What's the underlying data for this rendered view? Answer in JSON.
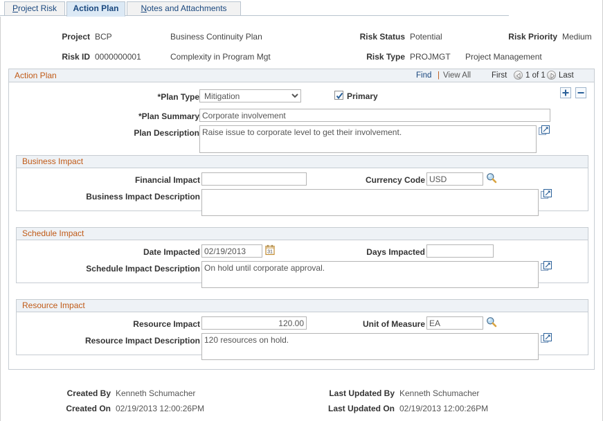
{
  "tabs": [
    {
      "label": "Project Risk",
      "accesskey": "P",
      "active": false
    },
    {
      "label": "Action Plan",
      "accesskey": "A",
      "active": true
    },
    {
      "label": "Notes and Attachments",
      "accesskey": "N",
      "active": true
    }
  ],
  "header": {
    "project_label": "Project",
    "project_value": "BCP",
    "project_desc": "Business Continuity Plan",
    "risk_id_label": "Risk ID",
    "risk_id_value": "0000000001",
    "risk_desc": "Complexity in Program Mgt",
    "risk_status_label": "Risk Status",
    "risk_status_value": "Potential",
    "risk_priority_label": "Risk Priority",
    "risk_priority_value": "Medium",
    "risk_type_label": "Risk Type",
    "risk_type_value": "PROJMGT",
    "risk_type_desc": "Project Management"
  },
  "action_plan": {
    "title": "Action Plan",
    "find_label": "Find",
    "separator": "|",
    "view_all_label": "View All",
    "first_label": "First",
    "counter": "1 of 1",
    "last_label": "Last",
    "add_row_label": "+",
    "delete_row_label": "-",
    "plan_type_label": "*Plan Type",
    "plan_type_value": "Mitigation",
    "plan_type_options": [
      "Mitigation"
    ],
    "primary_label": "Primary",
    "primary_checked": true,
    "plan_summary_label": "*Plan Summary",
    "plan_summary_value": "Corporate involvement",
    "plan_description_label": "Plan Description",
    "plan_description_value": "Raise issue to corporate level to get their involvement."
  },
  "business_impact": {
    "title": "Business Impact",
    "financial_impact_label": "Financial Impact",
    "financial_impact_value": "",
    "currency_code_label": "Currency Code",
    "currency_code_value": "USD",
    "description_label": "Business Impact Description",
    "description_value": ""
  },
  "schedule_impact": {
    "title": "Schedule Impact",
    "date_impacted_label": "Date Impacted",
    "date_impacted_value": "02/19/2013",
    "days_impacted_label": "Days Impacted",
    "days_impacted_value": "",
    "description_label": "Schedule Impact Description",
    "description_value": "On hold until corporate approval."
  },
  "resource_impact": {
    "title": "Resource Impact",
    "resource_impact_label": "Resource Impact",
    "resource_impact_value": "120.00",
    "unit_of_measure_label": "Unit of Measure",
    "unit_of_measure_value": "EA",
    "description_label": "Resource Impact Description",
    "description_value": "120 resources on hold."
  },
  "audit": {
    "created_by_label": "Created By",
    "created_by_value": "Kenneth Schumacher",
    "created_on_label": "Created On",
    "created_on_value": "02/19/2013 12:00:26PM",
    "last_updated_by_label": "Last Updated By",
    "last_updated_by_value": "Kenneth Schumacher",
    "last_updated_on_label": "Last Updated On",
    "last_updated_on_value": "02/19/2013 12:00:26PM"
  },
  "icons": {
    "expand_icon": "expand-textarea-icon",
    "lookup_icon": "magnifying-glass-lookup-icon",
    "calendar_icon": "calendar-picker-icon",
    "prev_icon": "previous-arrow-icon",
    "next_icon": "next-arrow-icon"
  },
  "colors": {
    "section_title": "#c05a17",
    "link": "#19477e",
    "active_tab_bg": "#dce9f5",
    "section_band": "#eef2f6"
  }
}
